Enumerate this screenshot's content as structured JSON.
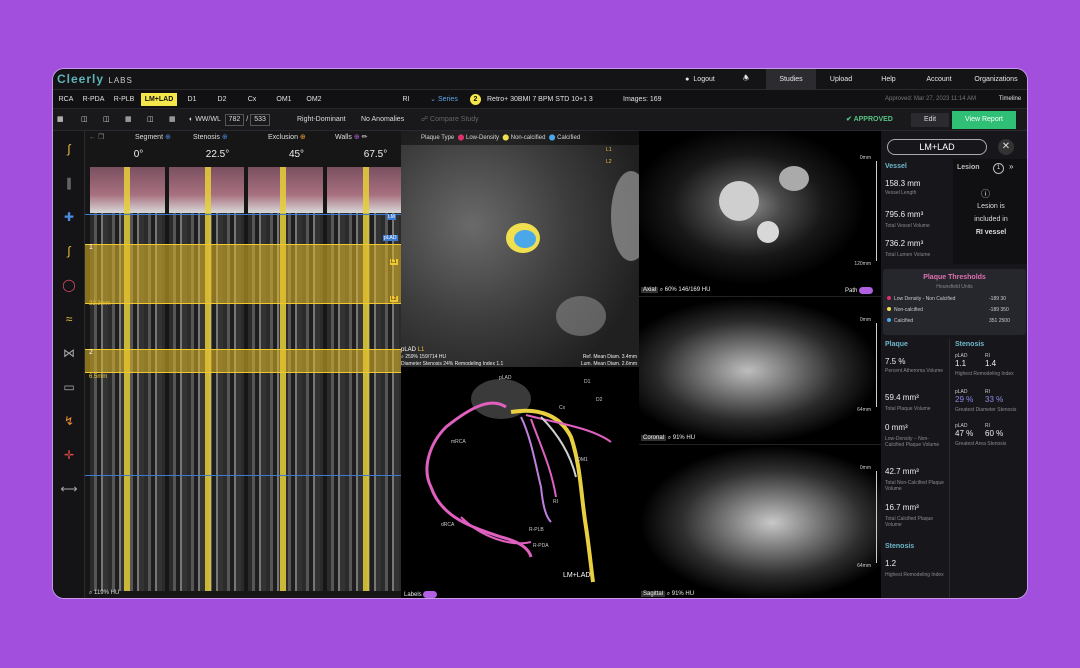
{
  "brand": {
    "name": "Cleerly",
    "suffix": "LABS"
  },
  "topnav": {
    "logout": "Logout",
    "studies": "Studies",
    "upload": "Upload",
    "help": "Help",
    "account": "Account",
    "organizations": "Organizations"
  },
  "vessel_tabs": [
    "RCA",
    "R-PDA",
    "R-PLB",
    "LM+LAD",
    "D1",
    "D2",
    "Cx",
    "OM1",
    "OM2",
    "RI"
  ],
  "series": {
    "label": "Series",
    "count": "2",
    "description": "Retro+ 30BMI 7 BPM STD 10+1 3",
    "images": "Images: 169",
    "approved_stamp": "Approved: Mar 27, 2023 11:14 AM",
    "timeline": "Timeline"
  },
  "toolbar": {
    "wwwl_label": "WW/WL",
    "ww": "782",
    "wl": "533",
    "slash": "/",
    "dominance": "Right-Dominant",
    "anomalies": "No Anomalies",
    "compare": "Compare Study",
    "approved": "APPROVED",
    "edit": "Edit",
    "view_report": "View Report"
  },
  "mpr": {
    "headers": [
      "Segment",
      "Stenosis",
      "Exclusion",
      "Walls"
    ],
    "angles": [
      "0°",
      "22.5°",
      "45°",
      "67.5°"
    ],
    "marker_1": "1",
    "marker_2": "2",
    "dist_1": "22.3mm",
    "dist_2": "6.5mm",
    "tag_lm": "LM",
    "tag_plad": "pLAD",
    "tag_l1": "L1",
    "tag_l2": "L2",
    "zoom": "119%",
    "hu": "HU"
  },
  "xsec": {
    "plaque_type": "Plaque Type",
    "low_density": "Low-Density",
    "non_calcified": "Non-calcified",
    "calcified": "Calcified",
    "tag_l1": "L1",
    "tag_l2": "L2",
    "segment": "pLAD",
    "segment_tag": "L1",
    "zoom": "259%",
    "slice": "159/714",
    "hu": "HU",
    "diameter_stenosis": "Diameter Stenosis 24%",
    "remodeling_index": "Remodeling Index 1.1",
    "ref_mean_diam": "Ref. Mean Diam. 3.4mm",
    "lum_mean_diam": "Lum. Mean Diam. 2.6mm"
  },
  "tree": {
    "labels_toggle": "Labels",
    "vessel_label": "LM+LAD",
    "small_labels": [
      "D1",
      "D2",
      "Cx",
      "OM1",
      "RI",
      "mRCA",
      "dRCA",
      "R-PLB",
      "R-PDA",
      "pLAD"
    ]
  },
  "axial": {
    "label": "Axial",
    "zoom": "60%",
    "slice": "146/169",
    "hu": "HU",
    "path": "Path",
    "scale_top": "0mm",
    "scale_bottom": "120mm"
  },
  "coronal": {
    "label": "Coronal",
    "zoom": "91%",
    "hu": "HU",
    "scale_top": "0mm",
    "scale_bottom": "64mm"
  },
  "sagittal": {
    "label": "Sagittal",
    "zoom": "91%",
    "hu": "HU",
    "scale_top": "0mm",
    "scale_bottom": "64mm"
  },
  "panel": {
    "vessel_name": "LM+LAD",
    "vessel_header": "Vessel",
    "vessel_length": "158.3 mm",
    "vessel_length_label": "Vessel Length",
    "total_vessel_volume": "795.6 mm³",
    "total_vessel_volume_label": "Total Vessel Volume",
    "total_lumen_volume": "736.2 mm³",
    "total_lumen_volume_label": "Total Lumen Volume",
    "lesion_header": "Lesion",
    "lesion_count": "1",
    "lesion_info_1": "Lesion is",
    "lesion_info_2": "included in",
    "lesion_info_3": "RI vessel",
    "thresholds_header": "Plaque Thresholds",
    "thresholds_sub": "Hounsfield Units",
    "thresholds": [
      {
        "name": "Low Density - Non Calcified",
        "range": "-189 30",
        "color": "#e0306a"
      },
      {
        "name": "Non-calcified",
        "range": "-189 350",
        "color": "#f0e050"
      },
      {
        "name": "Calcified",
        "range": "351 2500",
        "color": "#4aa8e8"
      }
    ],
    "plaque_header": "Plaque",
    "percent_atheroma": "7.5 %",
    "percent_atheroma_label": "Percent Atheroma Volume",
    "total_plaque": "59.4 mm³",
    "total_plaque_label": "Total Plaque Volume",
    "low_density": "0 mm³",
    "low_density_label": "Low-Density – Non-Calcified Plaque Volume",
    "non_calcified": "42.7 mm³",
    "non_calcified_label": "Total Non-Calcified Plaque Volume",
    "calcified": "16.7 mm³",
    "calcified_label": "Total Calcified Plaque Volume",
    "stenosis_header": "Stenosis",
    "remodel": "1.2",
    "remodel_label": "Highest Remodeling Index",
    "stenosis_col_header": "Stenosis",
    "st_row1_a_seg": "pLAD",
    "st_row1_a": "1.1",
    "st_row1_b_seg": "RI",
    "st_row1_b": "1.4",
    "st_row1_label": "Highest Remodeling Index",
    "st_row2_a_seg": "pLAD",
    "st_row2_a": "29 %",
    "st_row2_b_seg": "RI",
    "st_row2_b": "33 %",
    "st_row2_label": "Greatest Diameter Stenosis",
    "st_row3_a_seg": "pLAD",
    "st_row3_a": "47 %",
    "st_row3_b_seg": "RI",
    "st_row3_b": "60 %",
    "st_row3_label": "Greatest Area Stenosis"
  }
}
